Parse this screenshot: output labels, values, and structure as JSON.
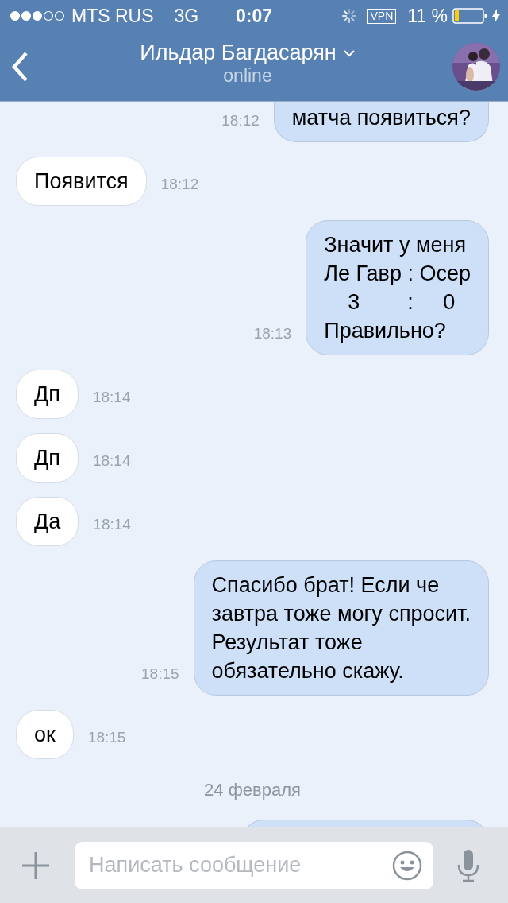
{
  "status_bar": {
    "carrier": "MTS RUS",
    "network": "3G",
    "time": "0:07",
    "vpn": "VPN",
    "battery": "11 %"
  },
  "header": {
    "name": "Ильдар Багдасарян",
    "status": "online"
  },
  "messages": [
    {
      "kind": "out",
      "lines": [
        "матча появиться?"
      ],
      "time": "18:12",
      "cut": true
    },
    {
      "kind": "in",
      "lines": [
        "Появится"
      ],
      "time": "18:12"
    },
    {
      "kind": "out",
      "lines": [
        "Значит у меня",
        "Ле Гавр : Осер",
        "    3        :     0",
        "Правильно?"
      ],
      "time": "18:13"
    },
    {
      "kind": "in",
      "lines": [
        "Дп"
      ],
      "time": "18:14"
    },
    {
      "kind": "in",
      "lines": [
        "Дп"
      ],
      "time": "18:14"
    },
    {
      "kind": "in",
      "lines": [
        "Да"
      ],
      "time": "18:14"
    },
    {
      "kind": "out",
      "lines": [
        "Спасибо брат! Если че",
        "завтра тоже могу спросит.",
        "Результат тоже",
        "обязательно скажу."
      ],
      "time": "18:15"
    },
    {
      "kind": "in",
      "lines": [
        "ок"
      ],
      "time": "18:15"
    },
    {
      "kind": "date",
      "text": "24 февраля"
    }
  ],
  "composer": {
    "placeholder": "Написать сообщение"
  }
}
